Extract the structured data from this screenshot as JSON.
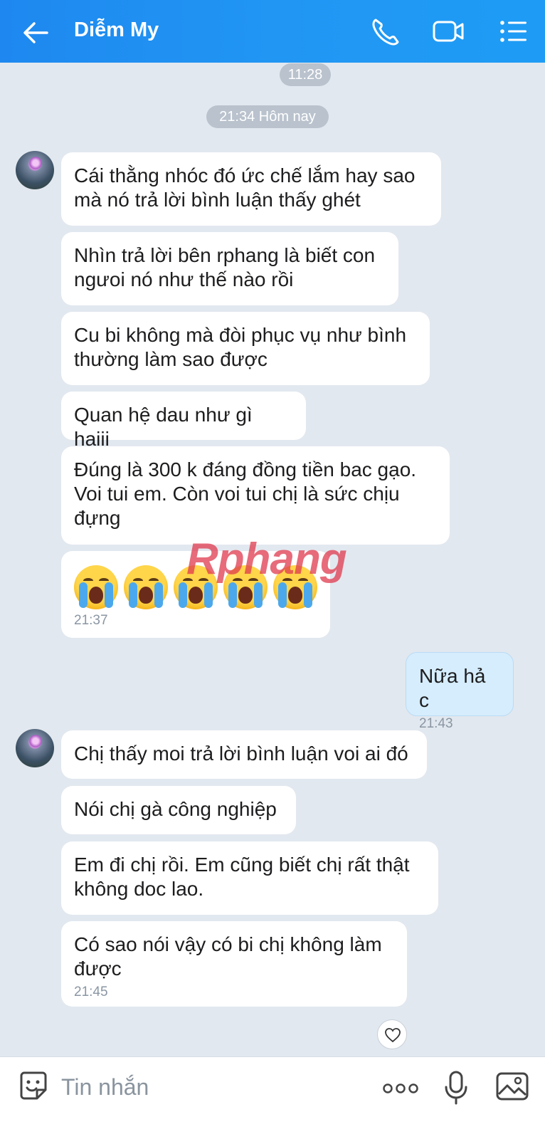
{
  "header": {
    "title": "Diễm My"
  },
  "chips": {
    "top_time": "11:28",
    "day_label": "21:34 Hôm nay"
  },
  "messages": [
    {
      "text": "Cái thằng nhóc đó ức chế lắm hay sao mà nó trả lời bình luận thấy ghét"
    },
    {
      "text": "Nhìn trả lời bên rphang là biết con ngưoi nó như thế nào rồi"
    },
    {
      "text": "Cu bi không mà đòi phục vụ như bình thường làm sao được"
    },
    {
      "text": "Quan hệ dau như gì haiii"
    },
    {
      "text": "Đúng là  300 k đáng đồng tiền bac gạo. Voi tui em. Còn voi tui chị là sức chịu đựng"
    },
    {
      "emoji": "crying-face",
      "count": 5,
      "time": "21:37"
    },
    {
      "text": "Nữa hả c",
      "time": "21:43",
      "sender": "me"
    },
    {
      "text": "Chị thấy moi trả lời bình luận voi ai đó"
    },
    {
      "text": "Nói chị gà công nghiệp"
    },
    {
      "text": "Em đi chị rồi. Em cũng biết chị rất thật không doc lao."
    },
    {
      "text": "Có sao nói vậy có bi chị không làm được",
      "time": "21:45"
    }
  ],
  "watermark": {
    "part1": "Rphang",
    "part2": ""
  },
  "composer": {
    "placeholder": "Tin nhắn"
  },
  "colors": {
    "header": "#2196f3",
    "background": "#e2e8ef",
    "my_bubble": "#d6edfd"
  }
}
